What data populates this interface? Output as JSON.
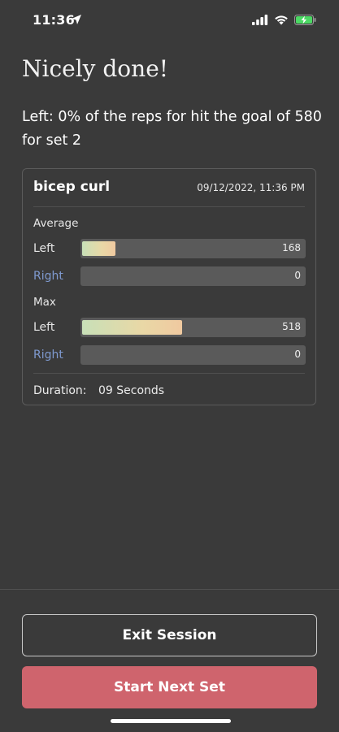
{
  "status_bar": {
    "time": "11:36",
    "icons": [
      "location-arrow-icon",
      "cellular-signal-icon",
      "wifi-icon",
      "battery-charging-icon"
    ]
  },
  "heading": "Nicely done!",
  "message": "Left: 0% of the reps for hit the goal of 580 for set 2",
  "card": {
    "exercise": "bicep curl",
    "datetime": "09/12/2022, 11:36 PM",
    "average": {
      "label": "Average",
      "rows": [
        {
          "side": "Left",
          "value": "168",
          "fill_fraction": 0.15
        },
        {
          "side": "Right",
          "value": "0",
          "fill_fraction": 0
        }
      ]
    },
    "max": {
      "label": "Max",
      "rows": [
        {
          "side": "Left",
          "value": "518",
          "fill_fraction": 0.45
        },
        {
          "side": "Right",
          "value": "0",
          "fill_fraction": 0
        }
      ]
    },
    "duration_label": "Duration:",
    "duration_value": "09 Seconds"
  },
  "buttons": {
    "exit": "Exit Session",
    "next": "Start Next Set"
  },
  "colors": {
    "background": "#3a3a3a",
    "accent_button": "#cf646d",
    "right_label": "#7f9ad0"
  }
}
